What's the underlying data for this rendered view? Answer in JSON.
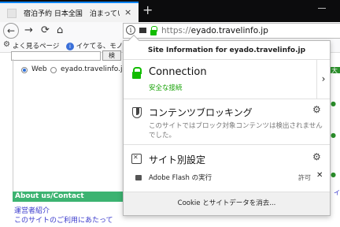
{
  "tab": {
    "title": "宿泊予約 日本全国　泊まってい",
    "close": "×",
    "new_tab": "+"
  },
  "nav": {
    "back": "←",
    "forward": "→",
    "reload": "⟳",
    "home": "⌂"
  },
  "url": {
    "scheme": "https://",
    "host": "eyado.",
    "domain": "travelinfo.jp"
  },
  "bookmarks": {
    "item1": "よく見るページ",
    "item2": "イケてる、モノ"
  },
  "page": {
    "search_button": "検",
    "radio_web": "Web",
    "radio_site": "eyado.travelinfo.jp",
    "about_title": "About us/Contact",
    "about_link1": "運営者紹介",
    "about_link2": "このサイトのご利用にあたって",
    "right_fragment": "大予",
    "right_fragment2": "イ"
  },
  "popup": {
    "header": "Site Information for eyado.travelinfo.jp",
    "connection_title": "Connection",
    "connection_status": "安全な接続",
    "content_blocking_title": "コンテンツブロッキング",
    "content_blocking_desc": "このサイトではブロック対象コンテンツは検出されませんでした。",
    "permissions_title": "サイト別設定",
    "permission_name": "Adobe Flash の実行",
    "permission_state": "許可",
    "clear_cookies": "Cookie とサイトデータを消去..."
  },
  "colors": {
    "secure_green": "#12bc00",
    "tab_accent": "#0a84ff",
    "about_bg": "#3cb371"
  }
}
